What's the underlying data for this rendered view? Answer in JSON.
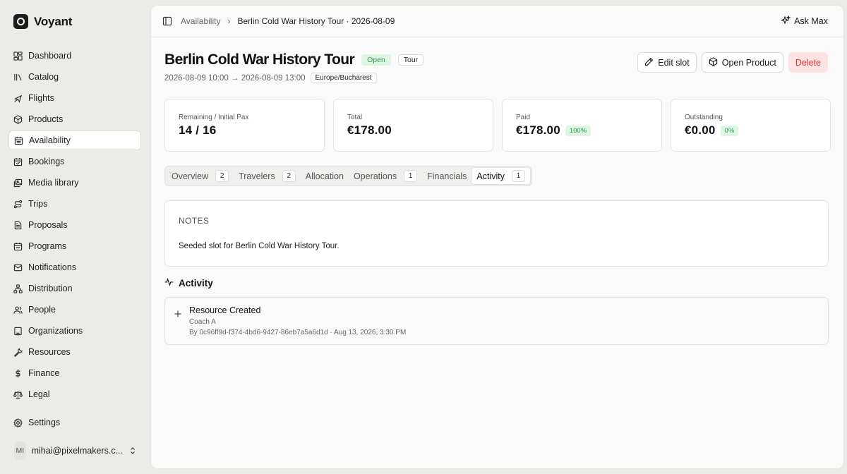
{
  "brand": {
    "name": "Voyant"
  },
  "sidebar": {
    "items": [
      {
        "label": "Dashboard",
        "icon": "dashboard-icon"
      },
      {
        "label": "Catalog",
        "icon": "catalog-icon"
      },
      {
        "label": "Flights",
        "icon": "plane-icon"
      },
      {
        "label": "Products",
        "icon": "package-icon"
      },
      {
        "label": "Availability",
        "icon": "calendar-icon",
        "active": true
      },
      {
        "label": "Bookings",
        "icon": "calendar-check-icon"
      },
      {
        "label": "Media library",
        "icon": "images-icon"
      },
      {
        "label": "Trips",
        "icon": "route-icon"
      },
      {
        "label": "Proposals",
        "icon": "file-text-icon"
      },
      {
        "label": "Programs",
        "icon": "calendar-range-icon"
      },
      {
        "label": "Notifications",
        "icon": "mail-icon"
      },
      {
        "label": "Distribution",
        "icon": "network-icon"
      },
      {
        "label": "People",
        "icon": "users-icon"
      },
      {
        "label": "Organizations",
        "icon": "building-icon"
      },
      {
        "label": "Resources",
        "icon": "wrench-icon"
      },
      {
        "label": "Finance",
        "icon": "dollar-icon"
      },
      {
        "label": "Legal",
        "icon": "scale-icon"
      }
    ],
    "settings": "Settings",
    "user": {
      "initials": "MI",
      "email": "mihai@pixelmakers.c..."
    }
  },
  "topbar": {
    "breadcrumb_parent": "Availability",
    "breadcrumb_separator": "›",
    "breadcrumb_current": "Berlin Cold War History Tour · 2026-08-09",
    "ask_label": "Ask Max"
  },
  "header": {
    "title": "Berlin Cold War History Tour",
    "status_badge": "Open",
    "type_badge": "Tour",
    "time_range": "2026-08-09 10:00 → 2026-08-09 13:00",
    "timezone": "Europe/Bucharest"
  },
  "actions": {
    "edit": "Edit slot",
    "open_product": "Open Product",
    "delete": "Delete"
  },
  "stats": [
    {
      "label": "Remaining / Initial Pax",
      "value": "14 / 16",
      "badge": ""
    },
    {
      "label": "Total",
      "value": "€178.00",
      "badge": ""
    },
    {
      "label": "Paid",
      "value": "€178.00",
      "badge": "100%"
    },
    {
      "label": "Outstanding",
      "value": "€0.00",
      "badge": "0%"
    }
  ],
  "tabs": [
    {
      "label": "Overview",
      "count": "2"
    },
    {
      "label": "Travelers",
      "count": "2"
    },
    {
      "label": "Allocation",
      "count": ""
    },
    {
      "label": "Operations",
      "count": "1"
    },
    {
      "label": "Financials",
      "count": ""
    },
    {
      "label": "Activity",
      "count": "1",
      "active": true
    }
  ],
  "notes": {
    "heading": "NOTES",
    "text": "Seeded slot for Berlin Cold War History Tour."
  },
  "activity": {
    "heading": "Activity",
    "entries": [
      {
        "title": "Resource Created",
        "subtitle": "Coach A",
        "meta": "By 0c96ff9d-f374-4bd6-9427-86eb7a5a6d1d · Aug 13, 2026, 3:30 PM"
      }
    ]
  },
  "colors": {
    "success_bg": "#dff5e3",
    "success_text": "#2f9e4f",
    "danger_bg": "#fde3e3",
    "danger_text": "#d93636"
  }
}
